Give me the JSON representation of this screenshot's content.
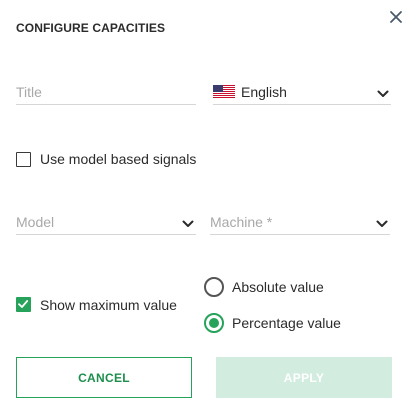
{
  "dialog": {
    "title": "CONFIGURE CAPACITIES",
    "close_icon": "close-icon"
  },
  "form": {
    "title_placeholder": "Title",
    "language": {
      "selected": "English",
      "flag_icon": "us-flag-icon"
    },
    "use_model_signals": {
      "label": "Use model based signals",
      "checked": false
    },
    "model_placeholder": "Model",
    "machine_placeholder": "Machine *",
    "show_max_value": {
      "label": "Show maximum value",
      "checked": true
    },
    "value_mode": {
      "options": [
        "Absolute value",
        "Percentage value"
      ],
      "selected": "Percentage value"
    }
  },
  "actions": {
    "cancel_label": "CANCEL",
    "apply_label": "APPLY"
  },
  "colors": {
    "accent": "#27a25a",
    "apply_disabled_bg": "#d2ece0",
    "placeholder": "#a8a8a8"
  }
}
